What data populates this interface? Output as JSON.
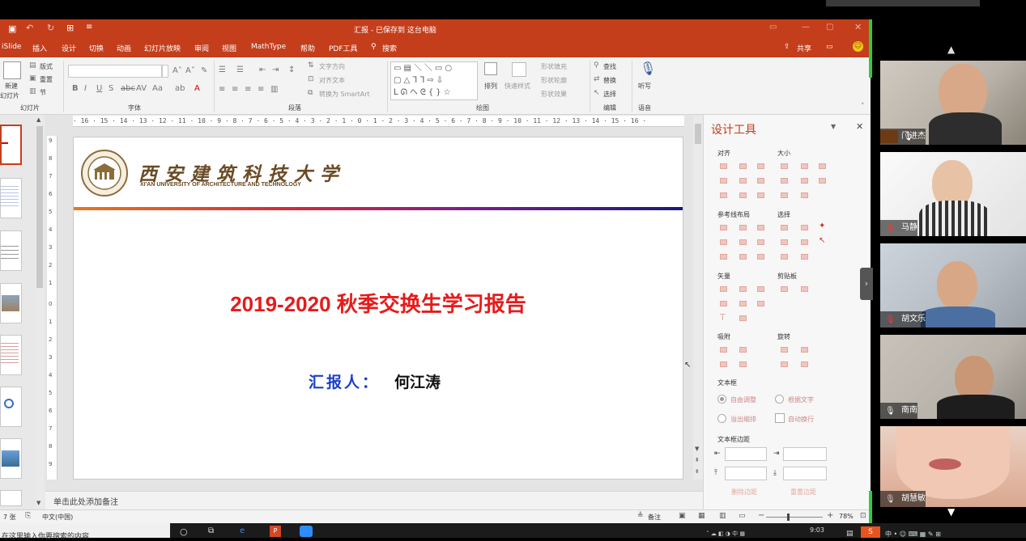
{
  "titlebar": {
    "filename": "汇报 - 已保存到 这台电脑"
  },
  "tabs": [
    "iSlide",
    "插入",
    "设计",
    "切换",
    "动画",
    "幻灯片放映",
    "审阅",
    "视图",
    "MathType",
    "帮助",
    "PDF工具",
    "搜索"
  ],
  "share_label": "共享",
  "ribbon": {
    "new_slide": "新建",
    "slides_label": "幻灯片",
    "layout": "版式",
    "reset": "重置",
    "section": "节",
    "group_slides": "幻灯片",
    "group_font": "字体",
    "group_paragraph": "段落",
    "group_drawing": "绘图",
    "group_editing": "编辑",
    "group_voice": "语音",
    "text_direction": "文字方向",
    "align_text": "对齐文本",
    "smartart": "转换为 SmartArt",
    "arrange": "排列",
    "quick_styles": "快速样式",
    "shape_fill": "形状填充",
    "shape_outline": "形状轮廓",
    "shape_effects": "形状效果",
    "find": "查找",
    "replace": "替换",
    "select": "选择",
    "dictate": "听写"
  },
  "ruler": "· 16 · 15 · 14 · 13 · 12 · 11 · 10 · 9 · 8 · 7 · 6 · 5 · 4 · 3 · 2 · 1 · 0 · 1 · 2 · 3 · 4 · 5 · 6 · 7 · 8 · 9 · 10 · 11 · 12 · 13 · 14 · 15 · 16 ·",
  "vruler": [
    "9",
    "8",
    "7",
    "6",
    "5",
    "4",
    "3",
    "2",
    "1",
    "0",
    "1",
    "2",
    "3",
    "4",
    "5",
    "6",
    "7",
    "8",
    "9"
  ],
  "slide": {
    "uni_name": "西安建筑科技大学",
    "uni_en": "XI'AN UNIVERSITY OF ARCHITECTURE AND TECHNOLOGY",
    "title": "2019-2020 秋季交换生学习报告",
    "reporter_label": "汇报人：",
    "reporter_name": "何江涛"
  },
  "notes_placeholder": "单击此处添加备注",
  "pane": {
    "title": "设计工具",
    "align": "对齐",
    "size": "大小",
    "guides": "参考线布局",
    "select": "选择",
    "vector": "矢量",
    "clipboard": "剪贴板",
    "snap": "吸附",
    "rotate": "旋转",
    "textbox": "文本框",
    "autofit": "自由调整",
    "fit_text": "根据文字",
    "overflow": "溢出缩排",
    "wrap": "自动换行",
    "margin": "文本框边距",
    "delete_margin": "删除边距",
    "reset_margin": "重置边距"
  },
  "status": {
    "slide_count": "7 张",
    "language": "中文(中国)",
    "notes": "备注",
    "zoom": "78%"
  },
  "taskbar": {
    "search_hint": "在这里输入你要搜索的内容",
    "time": "9:03"
  },
  "participants": [
    "门进杰",
    "马静",
    "胡文乐",
    "南南",
    "胡慧敏"
  ]
}
